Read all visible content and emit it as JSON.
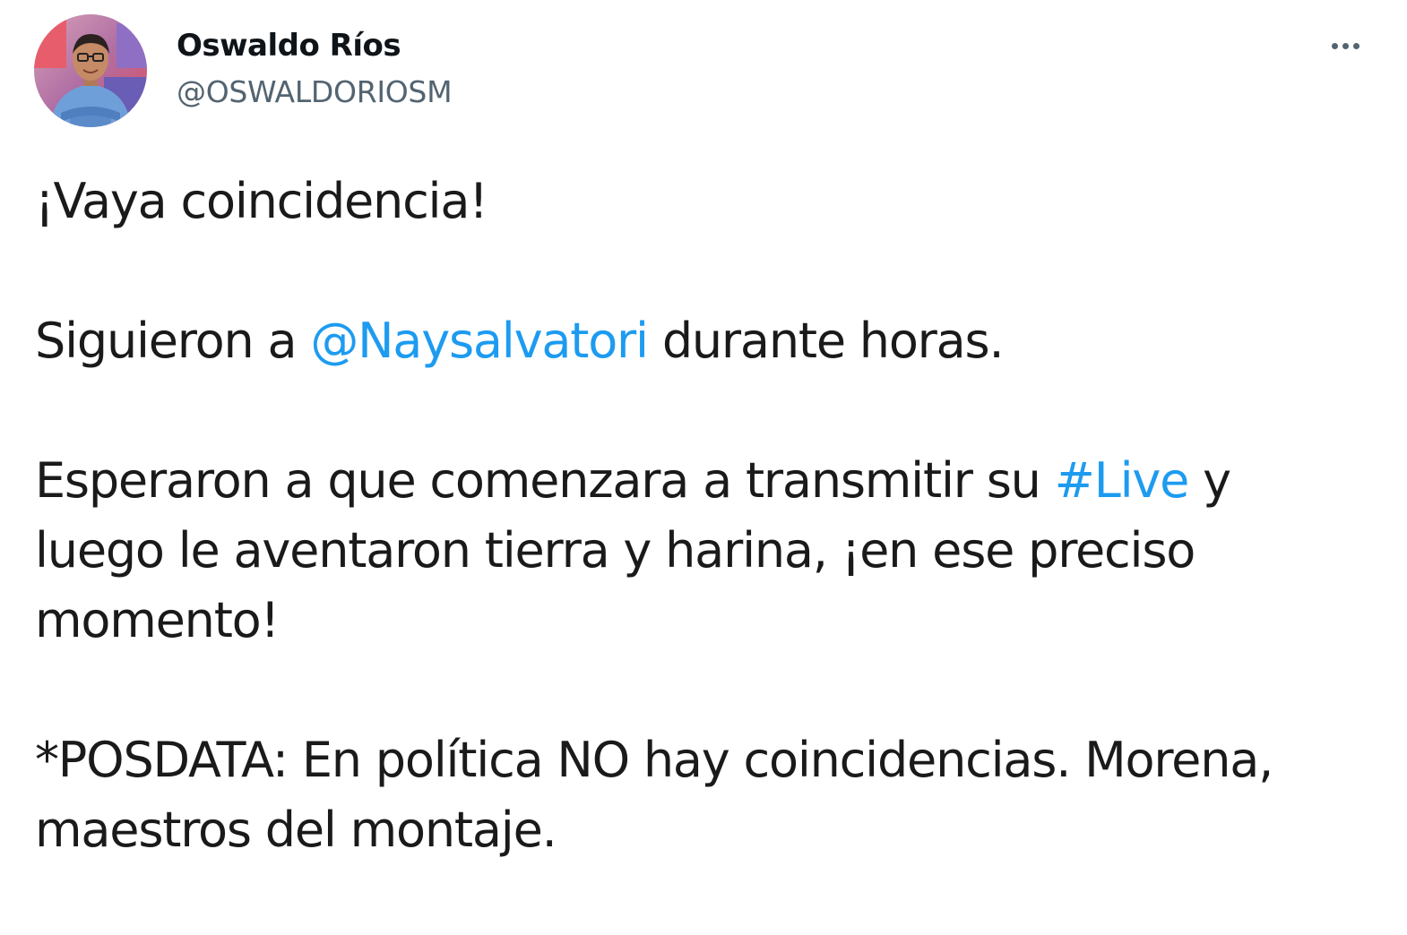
{
  "author": {
    "display_name": "Oswaldo Ríos",
    "handle": "@OSWALDORIOSM",
    "avatar_icon": "profile-photo"
  },
  "more_icon": "more-horizontal-icon",
  "colors": {
    "link": "#1d9bf0",
    "text": "#0f1419",
    "secondary": "#536471"
  },
  "tweet": {
    "p1": "¡Vaya coincidencia!",
    "p2": {
      "before": "Siguieron a ",
      "mention": "@Naysalvatori",
      "after": " durante horas."
    },
    "p3": {
      "line1_before": "Esperaron a que comenzara a transmitir su ",
      "hashtag": "#Live",
      "line1_after": " y",
      "line2": "luego le aventaron tierra y harina, ¡en ese preciso",
      "line3": "momento!"
    },
    "p4": {
      "line1": "*POSDATA: En política NO hay coincidencias. Morena,",
      "line2": "maestros del montaje."
    }
  }
}
